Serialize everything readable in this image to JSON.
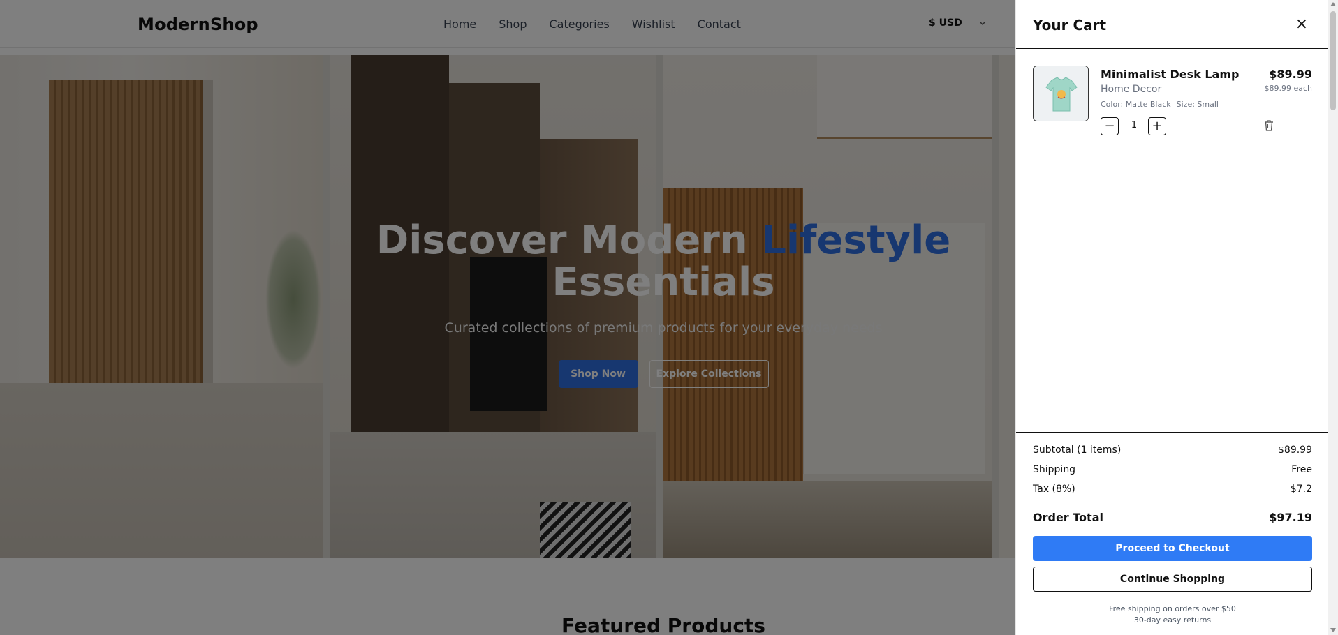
{
  "header": {
    "logo": "ModernShop",
    "nav": [
      "Home",
      "Shop",
      "Categories",
      "Wishlist",
      "Contact"
    ],
    "currency": "$ USD"
  },
  "hero": {
    "title_part1": "Discover Modern ",
    "title_accent": "Lifestyle",
    "title_part2": "Essentials",
    "subtitle": "Curated collections of premium products for your everyday needs",
    "primary_button": "Shop Now",
    "secondary_button": "Explore Collections"
  },
  "featured": {
    "heading": "Featured Products"
  },
  "cart": {
    "title": "Your Cart",
    "close_label": "×",
    "items": [
      {
        "name": "Minimalist Desk Lamp",
        "category": "Home Decor",
        "color": "Color: Matte Black",
        "size": "Size: Small",
        "price": "$89.99",
        "each": "$89.99 each",
        "quantity": "1",
        "minus": "−",
        "plus": "+"
      }
    ],
    "summary": {
      "subtotal_label": "Subtotal (1 items)",
      "subtotal_value": "$89.99",
      "shipping_label": "Shipping",
      "shipping_value": "Free",
      "tax_label": "Tax (8%)",
      "tax_value": "$7.2",
      "total_label": "Order Total",
      "total_value": "$97.19"
    },
    "checkout_button": "Proceed to Checkout",
    "continue_button": "Continue Shopping",
    "note_shipping": "Free shipping on orders over $50",
    "note_returns": "30-day easy returns"
  },
  "colors": {
    "accent": "#2f7bf5",
    "hero_accent": "#2f6fe0",
    "overlay": "rgba(0,0,0,0.5)"
  }
}
